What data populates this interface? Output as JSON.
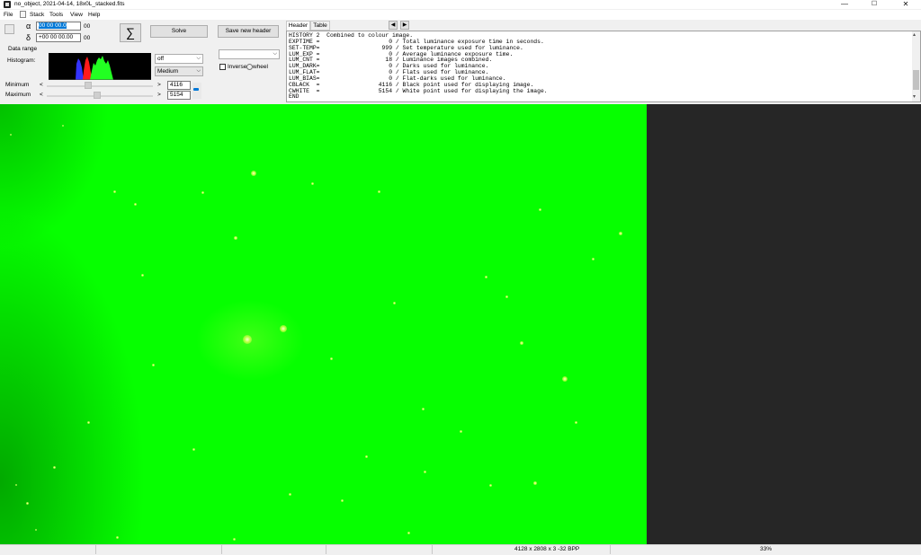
{
  "window": {
    "title": "no_object, 2021-04-14, 18x0L_stacked.fits",
    "min_glyph": "—",
    "max_glyph": "☐",
    "close_glyph": "✕"
  },
  "menu": [
    "File",
    "Stack",
    "Tools",
    "View",
    "Help"
  ],
  "coords": {
    "alpha_symbol": "α",
    "ra_value": "00 00 00.0",
    "ra_suffix": "00",
    "delta_symbol": "δ",
    "dec_value": "+00 00 00.00",
    "dec_suffix": "00"
  },
  "toolbar": {
    "sum_glyph": "∑",
    "solve_label": "Solve",
    "save_header_label": "Save new header"
  },
  "panel": {
    "data_range_label": "Data range",
    "histogram_label": "Histogram:",
    "minimum_label": "Minimum",
    "maximum_label": "Maximum",
    "min_value": "4116",
    "max_value": "5154",
    "stretch_value": "off",
    "quality_value": "Medium",
    "inverse_label": "Inverse",
    "wheel_label": "wheel",
    "arrow_left": "<",
    "arrow_right": ">",
    "min_slider": 0.38,
    "max_slider": 0.47
  },
  "tabs": {
    "header": "Header",
    "table": "Table",
    "prev": "◀",
    "next": "▶"
  },
  "fits_header": [
    "HISTORY 2  Combined to colour image.",
    "EXPTIME =                    0 / Total luminance exposure time in seconds.",
    "SET-TEMP=                  999 / Set temperature used for luminance.",
    "LUM_EXP =                    0 / Average luminance exposure time.",
    "LUM_CNT =                   18 / Luminance images combined.",
    "LUM_DARK=                    0 / Darks used for luminance.",
    "LUM_FLAT=                    0 / Flats used for luminance.",
    "LUM_BIAS=                    0 / Flat-darks used for luminance.",
    "CBLACK  =                 4116 / Black point used for displaying image.",
    "CWHITE  =                 5154 / White point used for displaying the image.",
    "END"
  ],
  "status": {
    "dimensions": "4128 x 2808 x 3  -32 BPP",
    "zoom": "33%"
  },
  "colors": {
    "image_green": "#06ff00",
    "background_dark": "#262626"
  }
}
